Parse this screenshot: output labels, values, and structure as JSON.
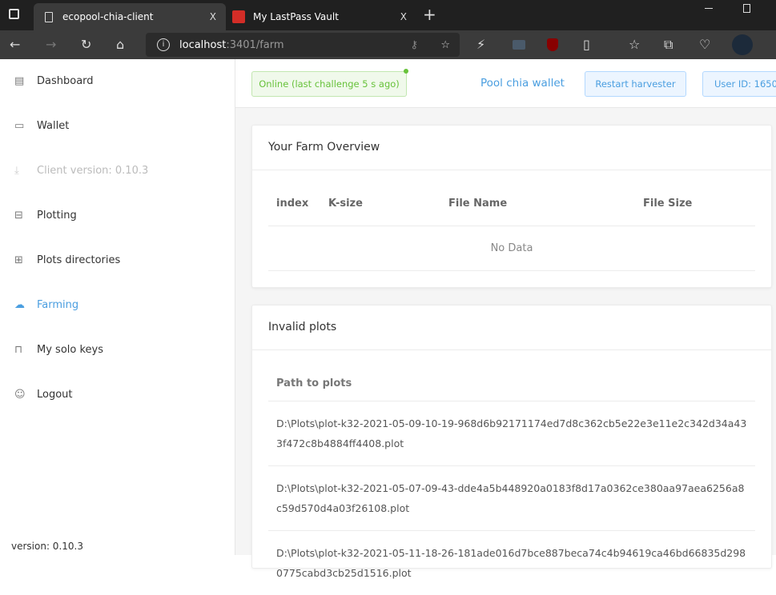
{
  "browser": {
    "tabs": [
      {
        "title": "ecopool-chia-client",
        "close": "X"
      },
      {
        "title": "My LastPass Vault",
        "close": "X"
      }
    ],
    "new_tab": "+",
    "url_host": "localhost",
    "url_path": ":3401/farm"
  },
  "sidebar": {
    "items": [
      {
        "label": "Dashboard",
        "icon": "chart-icon"
      },
      {
        "label": "Wallet",
        "icon": "wallet-icon"
      },
      {
        "label": "Client version: 0.10.3",
        "icon": "download-icon"
      },
      {
        "label": "Plotting",
        "icon": "inbox-icon"
      },
      {
        "label": "Plots directories",
        "icon": "folder-add-icon"
      },
      {
        "label": "Farming",
        "icon": "cloud-icon"
      },
      {
        "label": "My solo keys",
        "icon": "lock-icon"
      },
      {
        "label": "Logout",
        "icon": "user-icon"
      }
    ],
    "version": "version: 0.10.3"
  },
  "header": {
    "status": "Online (last challenge 5 s ago)",
    "pool_wallet": "Pool chia wallet",
    "restart": "Restart harvester",
    "user_id": "User ID: 1650"
  },
  "farm": {
    "title": "Your Farm Overview",
    "columns": [
      "index",
      "K-size",
      "File Name",
      "File Size"
    ],
    "empty": "No Data"
  },
  "invalid": {
    "title": "Invalid plots",
    "column": "Path to plots",
    "rows": [
      "D:\\Plots\\plot-k32-2021-05-09-10-19-968d6b92171174ed7d8c362cb5e22e3e11e2c342d34a433f472c8b4884ff4408.plot",
      "D:\\Plots\\plot-k32-2021-05-07-09-43-dde4a5b448920a0183f8d17a0362ce380aa97aea6256a8c59d570d4a03f26108.plot",
      "D:\\Plots\\plot-k32-2021-05-11-18-26-181ade016d7bce887beca74c4b94619ca46bd66835d2980775cabd3cb25d1516.plot"
    ]
  }
}
